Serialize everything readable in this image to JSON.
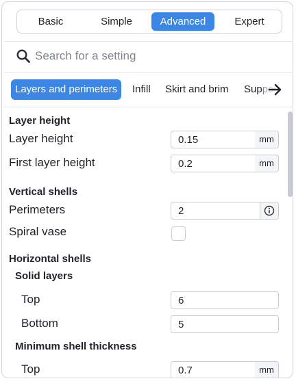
{
  "modes": [
    "Basic",
    "Simple",
    "Advanced",
    "Expert"
  ],
  "active_mode": "Advanced",
  "search": {
    "placeholder": "Search for a setting",
    "value": ""
  },
  "tabs": [
    "Layers and perimeters",
    "Infill",
    "Skirt and brim",
    "Supports"
  ],
  "active_tab": "Layers and perimeters",
  "icons": {
    "search": "search-icon",
    "scroll_tabs": "arrow-right-icon",
    "info": "info-icon"
  },
  "colors": {
    "accent": "#3c87e6",
    "border": "#c9cdd2",
    "unit_bg": "#f4f5f6"
  },
  "settings": {
    "layer_height_section": "Layer height",
    "layer_height": {
      "label": "Layer height",
      "value": "0.15",
      "unit": "mm"
    },
    "first_layer_height": {
      "label": "First layer height",
      "value": "0.2",
      "unit": "mm"
    },
    "vertical_shells_section": "Vertical shells",
    "perimeters": {
      "label": "Perimeters",
      "value": "2"
    },
    "spiral_vase": {
      "label": "Spiral vase",
      "checked": false
    },
    "horizontal_shells_section": "Horizontal shells",
    "solid_layers_subsection": "Solid layers",
    "solid_top": {
      "label": "Top",
      "value": "6"
    },
    "solid_bottom": {
      "label": "Bottom",
      "value": "5"
    },
    "min_shell_subsection": "Minimum shell thickness",
    "min_shell_top": {
      "label": "Top",
      "value": "0.7",
      "unit": "mm"
    }
  }
}
